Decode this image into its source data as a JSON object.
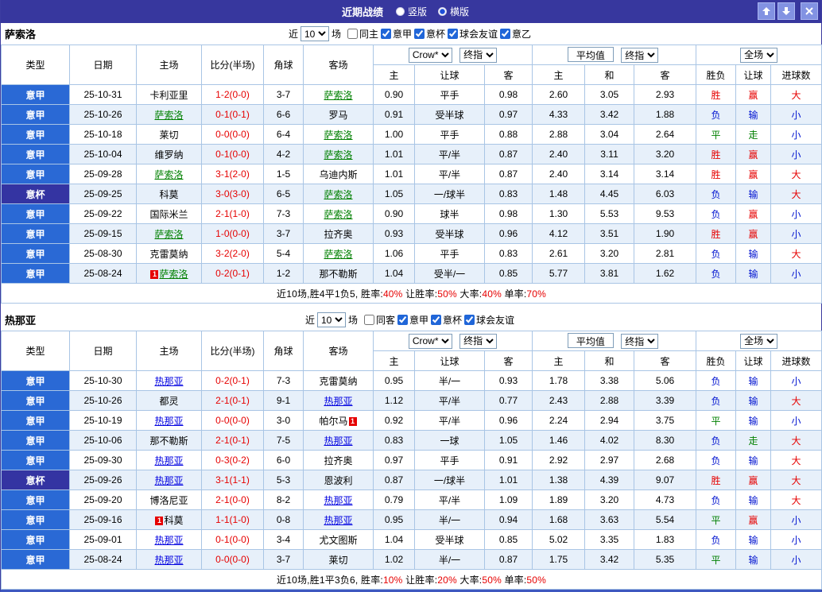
{
  "titlebar": {
    "title": "近期战绩",
    "radios": [
      {
        "label": "竖版",
        "selected": false
      },
      {
        "label": "横版",
        "selected": true
      }
    ]
  },
  "colors": {
    "titlebar_bg": "#37379e",
    "league_blue": "#2a69d5",
    "cup_navy": "#3434a2",
    "win_red": "#e60000",
    "lose_blue": "#0013d0",
    "draw_green": "#008000",
    "row_alt": "#e7f0fa",
    "grid_border": "#a9c5e5"
  },
  "columns": [
    "类型",
    "日期",
    "主场",
    "比分(半场)",
    "角球",
    "客场",
    "主",
    "让球",
    "客",
    "主",
    "和",
    "客",
    "胜负",
    "让球",
    "进球数"
  ],
  "controls": {
    "company_select": "Crow*",
    "odds_final_select": "终指",
    "average_label": "平均值",
    "avg_final_select": "终指",
    "scope_select": "全场"
  },
  "sections": [
    {
      "team": "萨索洛",
      "team_color": "green",
      "filter": {
        "near_label": "近",
        "count": "10",
        "games_label": "场",
        "checkboxes": [
          {
            "label": "同主",
            "checked": false
          },
          {
            "label": "意甲",
            "checked": true
          },
          {
            "label": "意杯",
            "checked": true
          },
          {
            "label": "球会友谊",
            "checked": true
          },
          {
            "label": "意乙",
            "checked": true
          }
        ]
      },
      "rows": [
        {
          "league": "意甲",
          "date": "25-10-31",
          "home": {
            "name": "卡利亚里"
          },
          "score": "1-2(0-0)",
          "corners": "3-7",
          "away": {
            "name": "萨索洛",
            "focus": true
          },
          "odds": [
            "0.90",
            "平手",
            "0.98"
          ],
          "avg": [
            "2.60",
            "3.05",
            "2.93"
          ],
          "results": [
            "胜",
            "赢",
            "大"
          ]
        },
        {
          "league": "意甲",
          "date": "25-10-26",
          "home": {
            "name": "萨索洛",
            "focus": true
          },
          "score": "0-1(0-1)",
          "corners": "6-6",
          "away": {
            "name": "罗马"
          },
          "odds": [
            "0.91",
            "受半球",
            "0.97"
          ],
          "avg": [
            "4.33",
            "3.42",
            "1.88"
          ],
          "results": [
            "负",
            "输",
            "小"
          ]
        },
        {
          "league": "意甲",
          "date": "25-10-18",
          "home": {
            "name": "莱切"
          },
          "score": "0-0(0-0)",
          "corners": "6-4",
          "away": {
            "name": "萨索洛",
            "focus": true
          },
          "odds": [
            "1.00",
            "平手",
            "0.88"
          ],
          "avg": [
            "2.88",
            "3.04",
            "2.64"
          ],
          "results": [
            "平",
            "走",
            "小"
          ]
        },
        {
          "league": "意甲",
          "date": "25-10-04",
          "home": {
            "name": "维罗纳"
          },
          "score": "0-1(0-0)",
          "corners": "4-2",
          "away": {
            "name": "萨索洛",
            "focus": true
          },
          "odds": [
            "1.01",
            "平/半",
            "0.87"
          ],
          "avg": [
            "2.40",
            "3.11",
            "3.20"
          ],
          "results": [
            "胜",
            "赢",
            "小"
          ]
        },
        {
          "league": "意甲",
          "date": "25-09-28",
          "home": {
            "name": "萨索洛",
            "focus": true
          },
          "score": "3-1(2-0)",
          "corners": "1-5",
          "away": {
            "name": "乌迪内斯"
          },
          "odds": [
            "1.01",
            "平/半",
            "0.87"
          ],
          "avg": [
            "2.40",
            "3.14",
            "3.14"
          ],
          "results": [
            "胜",
            "赢",
            "大"
          ]
        },
        {
          "league": "意杯",
          "date": "25-09-25",
          "home": {
            "name": "科莫"
          },
          "score": "3-0(3-0)",
          "corners": "6-5",
          "away": {
            "name": "萨索洛",
            "focus": true
          },
          "odds": [
            "1.05",
            "一/球半",
            "0.83"
          ],
          "avg": [
            "1.48",
            "4.45",
            "6.03"
          ],
          "results": [
            "负",
            "输",
            "大"
          ]
        },
        {
          "league": "意甲",
          "date": "25-09-22",
          "home": {
            "name": "国际米兰"
          },
          "score": "2-1(1-0)",
          "corners": "7-3",
          "away": {
            "name": "萨索洛",
            "focus": true
          },
          "odds": [
            "0.90",
            "球半",
            "0.98"
          ],
          "avg": [
            "1.30",
            "5.53",
            "9.53"
          ],
          "results": [
            "负",
            "赢",
            "小"
          ]
        },
        {
          "league": "意甲",
          "date": "25-09-15",
          "home": {
            "name": "萨索洛",
            "focus": true
          },
          "score": "1-0(0-0)",
          "corners": "3-7",
          "away": {
            "name": "拉齐奥"
          },
          "odds": [
            "0.93",
            "受半球",
            "0.96"
          ],
          "avg": [
            "4.12",
            "3.51",
            "1.90"
          ],
          "results": [
            "胜",
            "赢",
            "小"
          ]
        },
        {
          "league": "意甲",
          "date": "25-08-30",
          "home": {
            "name": "克雷莫纳"
          },
          "score": "3-2(2-0)",
          "corners": "5-4",
          "away": {
            "name": "萨索洛",
            "focus": true
          },
          "odds": [
            "1.06",
            "平手",
            "0.83"
          ],
          "avg": [
            "2.61",
            "3.20",
            "2.81"
          ],
          "results": [
            "负",
            "输",
            "大"
          ]
        },
        {
          "league": "意甲",
          "date": "25-08-24",
          "home": {
            "name": "萨索洛",
            "focus": true,
            "badge": "1",
            "badge_pos": "before"
          },
          "score": "0-2(0-1)",
          "corners": "1-2",
          "away": {
            "name": "那不勒斯"
          },
          "odds": [
            "1.04",
            "受半/一",
            "0.85"
          ],
          "avg": [
            "5.77",
            "3.81",
            "1.62"
          ],
          "results": [
            "负",
            "输",
            "小"
          ]
        }
      ],
      "summary": [
        {
          "text": "近10场,胜4平1负5, 胜率:",
          "color": "black"
        },
        {
          "text": "40%",
          "color": "red"
        },
        {
          "text": " 让胜率:",
          "color": "black"
        },
        {
          "text": "50%",
          "color": "red"
        },
        {
          "text": " 大率:",
          "color": "black"
        },
        {
          "text": "40%",
          "color": "red"
        },
        {
          "text": " 单率:",
          "color": "black"
        },
        {
          "text": "70%",
          "color": "red"
        }
      ]
    },
    {
      "team": "热那亚",
      "team_color": "blue",
      "filter": {
        "near_label": "近",
        "count": "10",
        "games_label": "场",
        "checkboxes": [
          {
            "label": "同客",
            "checked": false
          },
          {
            "label": "意甲",
            "checked": true
          },
          {
            "label": "意杯",
            "checked": true
          },
          {
            "label": "球会友谊",
            "checked": true
          }
        ]
      },
      "rows": [
        {
          "league": "意甲",
          "date": "25-10-30",
          "home": {
            "name": "热那亚",
            "focus": true
          },
          "score": "0-2(0-1)",
          "corners": "7-3",
          "away": {
            "name": "克雷莫纳"
          },
          "odds": [
            "0.95",
            "半/一",
            "0.93"
          ],
          "avg": [
            "1.78",
            "3.38",
            "5.06"
          ],
          "results": [
            "负",
            "输",
            "小"
          ]
        },
        {
          "league": "意甲",
          "date": "25-10-26",
          "home": {
            "name": "都灵"
          },
          "score": "2-1(0-1)",
          "corners": "9-1",
          "away": {
            "name": "热那亚",
            "focus": true
          },
          "odds": [
            "1.12",
            "平/半",
            "0.77"
          ],
          "avg": [
            "2.43",
            "2.88",
            "3.39"
          ],
          "results": [
            "负",
            "输",
            "大"
          ]
        },
        {
          "league": "意甲",
          "date": "25-10-19",
          "home": {
            "name": "热那亚",
            "focus": true
          },
          "score": "0-0(0-0)",
          "corners": "3-0",
          "away": {
            "name": "帕尔马",
            "badge": "1",
            "badge_pos": "after"
          },
          "odds": [
            "0.92",
            "平/半",
            "0.96"
          ],
          "avg": [
            "2.24",
            "2.94",
            "3.75"
          ],
          "results": [
            "平",
            "输",
            "小"
          ]
        },
        {
          "league": "意甲",
          "date": "25-10-06",
          "home": {
            "name": "那不勒斯"
          },
          "score": "2-1(0-1)",
          "corners": "7-5",
          "away": {
            "name": "热那亚",
            "focus": true
          },
          "odds": [
            "0.83",
            "一球",
            "1.05"
          ],
          "avg": [
            "1.46",
            "4.02",
            "8.30"
          ],
          "results": [
            "负",
            "走",
            "大"
          ]
        },
        {
          "league": "意甲",
          "date": "25-09-30",
          "home": {
            "name": "热那亚",
            "focus": true
          },
          "score": "0-3(0-2)",
          "corners": "6-0",
          "away": {
            "name": "拉齐奥"
          },
          "odds": [
            "0.97",
            "平手",
            "0.91"
          ],
          "avg": [
            "2.92",
            "2.97",
            "2.68"
          ],
          "results": [
            "负",
            "输",
            "大"
          ]
        },
        {
          "league": "意杯",
          "date": "25-09-26",
          "home": {
            "name": "热那亚",
            "focus": true
          },
          "score": "3-1(1-1)",
          "corners": "5-3",
          "away": {
            "name": "恩波利"
          },
          "odds": [
            "0.87",
            "一/球半",
            "1.01"
          ],
          "avg": [
            "1.38",
            "4.39",
            "9.07"
          ],
          "results": [
            "胜",
            "赢",
            "大"
          ]
        },
        {
          "league": "意甲",
          "date": "25-09-20",
          "home": {
            "name": "博洛尼亚"
          },
          "score": "2-1(0-0)",
          "corners": "8-2",
          "away": {
            "name": "热那亚",
            "focus": true
          },
          "odds": [
            "0.79",
            "平/半",
            "1.09"
          ],
          "avg": [
            "1.89",
            "3.20",
            "4.73"
          ],
          "results": [
            "负",
            "输",
            "大"
          ]
        },
        {
          "league": "意甲",
          "date": "25-09-16",
          "home": {
            "name": "科莫",
            "badge": "1",
            "badge_pos": "before"
          },
          "score": "1-1(1-0)",
          "corners": "0-8",
          "away": {
            "name": "热那亚",
            "focus": true
          },
          "odds": [
            "0.95",
            "半/一",
            "0.94"
          ],
          "avg": [
            "1.68",
            "3.63",
            "5.54"
          ],
          "results": [
            "平",
            "赢",
            "小"
          ]
        },
        {
          "league": "意甲",
          "date": "25-09-01",
          "home": {
            "name": "热那亚",
            "focus": true
          },
          "score": "0-1(0-0)",
          "corners": "3-4",
          "away": {
            "name": "尤文图斯"
          },
          "odds": [
            "1.04",
            "受半球",
            "0.85"
          ],
          "avg": [
            "5.02",
            "3.35",
            "1.83"
          ],
          "results": [
            "负",
            "输",
            "小"
          ]
        },
        {
          "league": "意甲",
          "date": "25-08-24",
          "home": {
            "name": "热那亚",
            "focus": true
          },
          "score": "0-0(0-0)",
          "corners": "3-7",
          "away": {
            "name": "莱切"
          },
          "odds": [
            "1.02",
            "半/一",
            "0.87"
          ],
          "avg": [
            "1.75",
            "3.42",
            "5.35"
          ],
          "results": [
            "平",
            "输",
            "小"
          ]
        }
      ],
      "summary": [
        {
          "text": "近10场,胜1平3负6, 胜率:",
          "color": "black"
        },
        {
          "text": "10%",
          "color": "red"
        },
        {
          "text": " 让胜率:",
          "color": "black"
        },
        {
          "text": "20%",
          "color": "red"
        },
        {
          "text": " 大率:",
          "color": "black"
        },
        {
          "text": "50%",
          "color": "red"
        },
        {
          "text": " 单率:",
          "color": "black"
        },
        {
          "text": "50%",
          "color": "red"
        }
      ]
    }
  ]
}
